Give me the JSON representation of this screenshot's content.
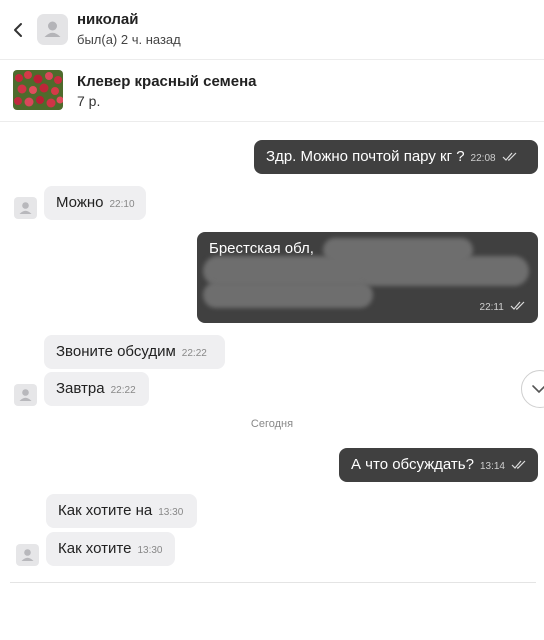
{
  "header": {
    "user_name": "николай",
    "user_status": "был(а) 2 ч. назад"
  },
  "product": {
    "title": "Клевер красный семена",
    "price": "7 р."
  },
  "messages": [
    {
      "direction": "out",
      "text": "Здр. Можно почтой пару кг ?",
      "time": "22:08"
    },
    {
      "direction": "in",
      "text": "Можно",
      "time": "22:10"
    },
    {
      "direction": "out",
      "text": "Брестская обл,",
      "time": "22:11",
      "redacted": true
    },
    {
      "direction": "in",
      "text": "Звоните обсудим",
      "time": "22:22"
    },
    {
      "direction": "in",
      "text": "Завтра",
      "time": "22:22"
    },
    {
      "direction": "out",
      "text": "А что обсуждать?",
      "time": "13:14"
    },
    {
      "direction": "in",
      "text": "Как хотите на",
      "time": "13:30"
    },
    {
      "direction": "in",
      "text": "Как хотите",
      "time": "13:30"
    }
  ],
  "day_separator": "Сегодня",
  "colors": {
    "outgoing_bubble": "#404040",
    "incoming_bubble": "#efeff1"
  },
  "icons": [
    "back-arrow-icon",
    "user-avatar-icon",
    "double-check-icon",
    "chevron-down-icon"
  ]
}
